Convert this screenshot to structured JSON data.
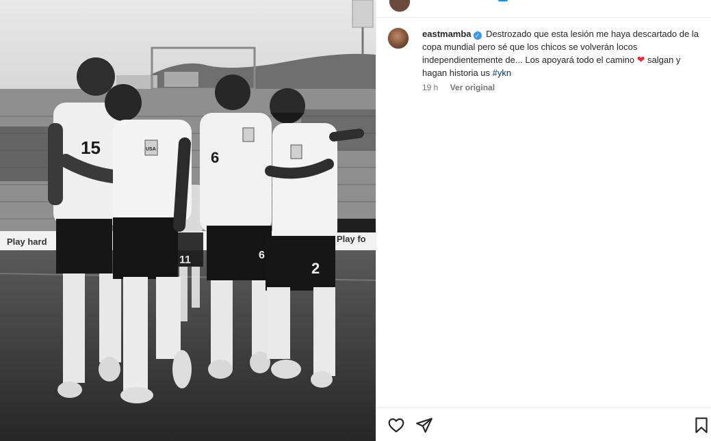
{
  "post": {
    "author": "eastmamba",
    "verified": true,
    "caption_part1": "Destrozado que esta lesión me haya descartado de la copa mundial pero sé que los chicos se volverán locos independientemente de... Los apoyará todo el camino",
    "caption_heart": "❤️",
    "caption_part2": "salgan y hagan historia us",
    "hashtag": "#ykn",
    "time": "19 h",
    "see_original": "Ver original"
  },
  "photo": {
    "jersey_numbers": [
      "15",
      "6",
      "2",
      "11",
      "6"
    ],
    "crest_text": "USA",
    "banner_text": "Play hard",
    "banner_text_right": "Play fo"
  },
  "icons": {
    "like": "heart-outline-icon",
    "share": "send-icon",
    "save": "bookmark-icon",
    "verified": "verified-badge-icon"
  },
  "colors": {
    "link": "#00376b",
    "verified": "#3897f0",
    "heart": "#ed2a3a"
  }
}
